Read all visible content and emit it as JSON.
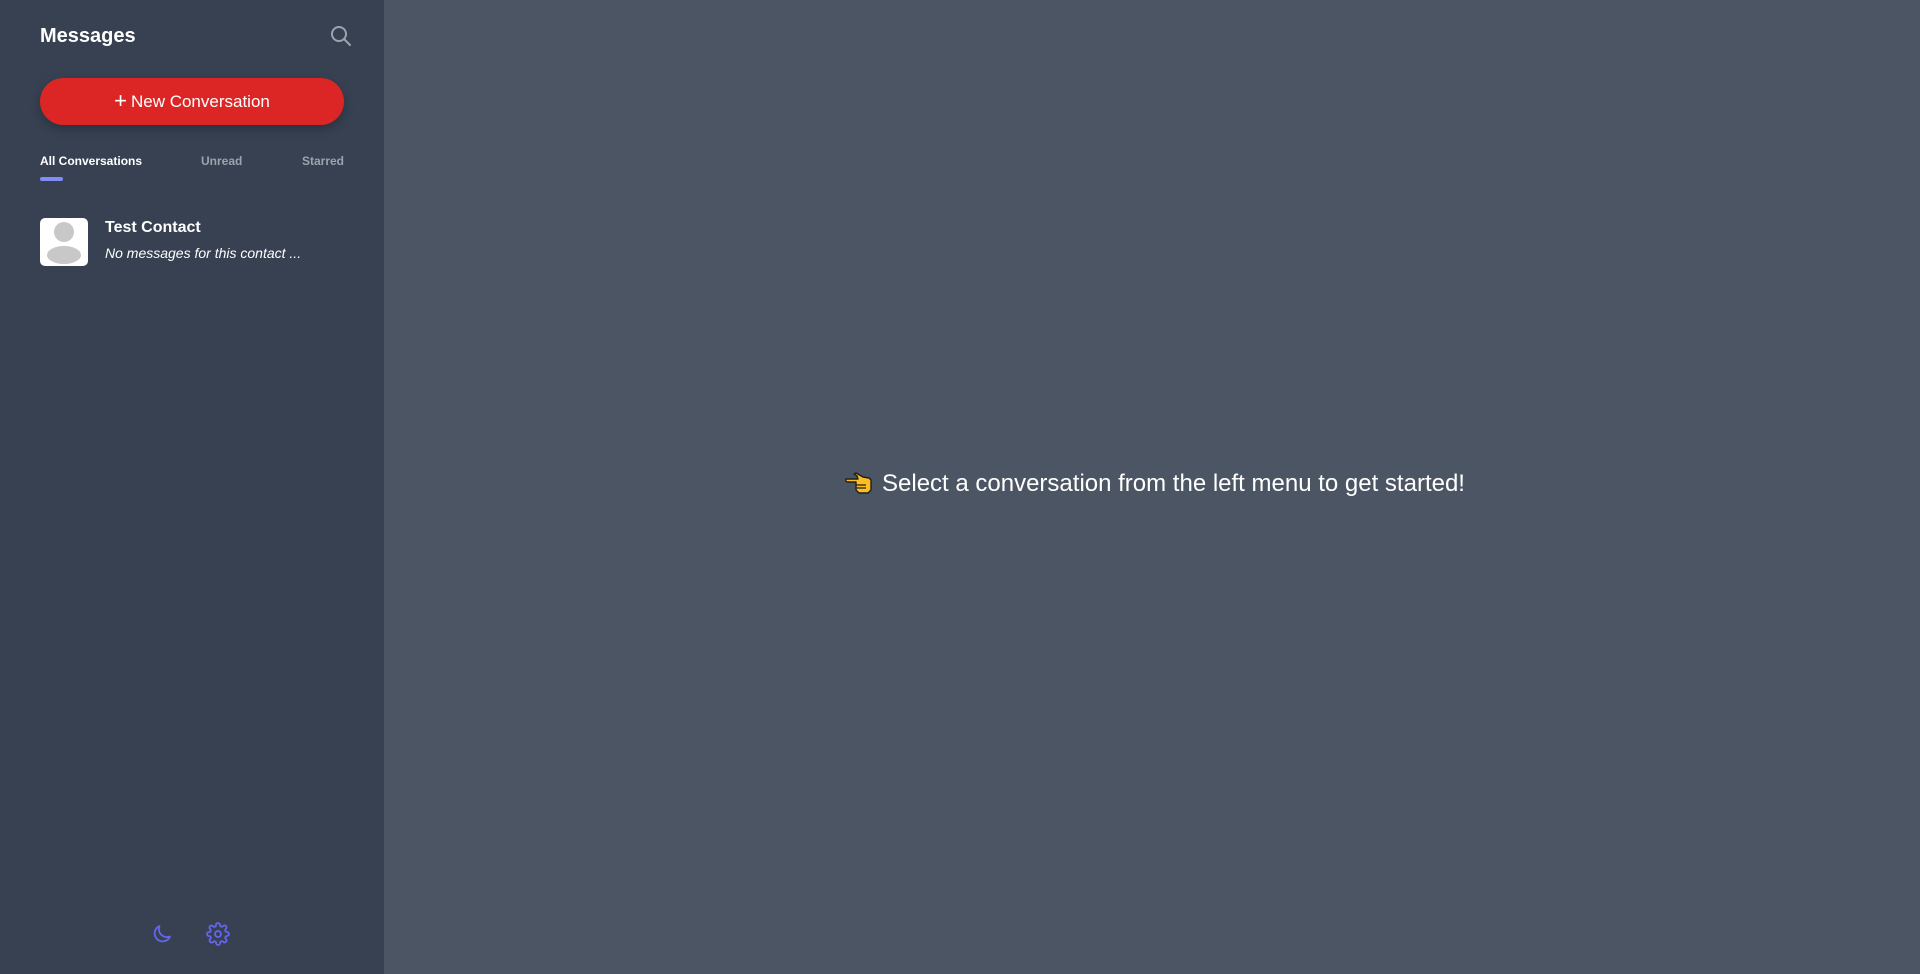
{
  "sidebar": {
    "title": "Messages",
    "search_icon": "search-icon",
    "new_conversation": {
      "icon": "+",
      "label": "New Conversation",
      "color": "#dc2626"
    },
    "tabs": [
      {
        "label": "All Conversations",
        "active": true
      },
      {
        "label": "Unread",
        "active": false
      },
      {
        "label": "Starred",
        "active": false
      }
    ],
    "conversations": [
      {
        "name": "Test Contact",
        "preview": "No messages for this contact ..."
      }
    ],
    "footer": {
      "moon_icon": "moon-icon",
      "gear_icon": "gear-icon",
      "accent": "#6366f1"
    }
  },
  "main": {
    "empty_message": "Select a conversation from the left menu to get started!",
    "empty_icon": "pointing-hand-icon"
  },
  "colors": {
    "sidebar_bg": "#374151",
    "main_bg": "#4b5563",
    "tab_indicator": "#818cf8"
  }
}
